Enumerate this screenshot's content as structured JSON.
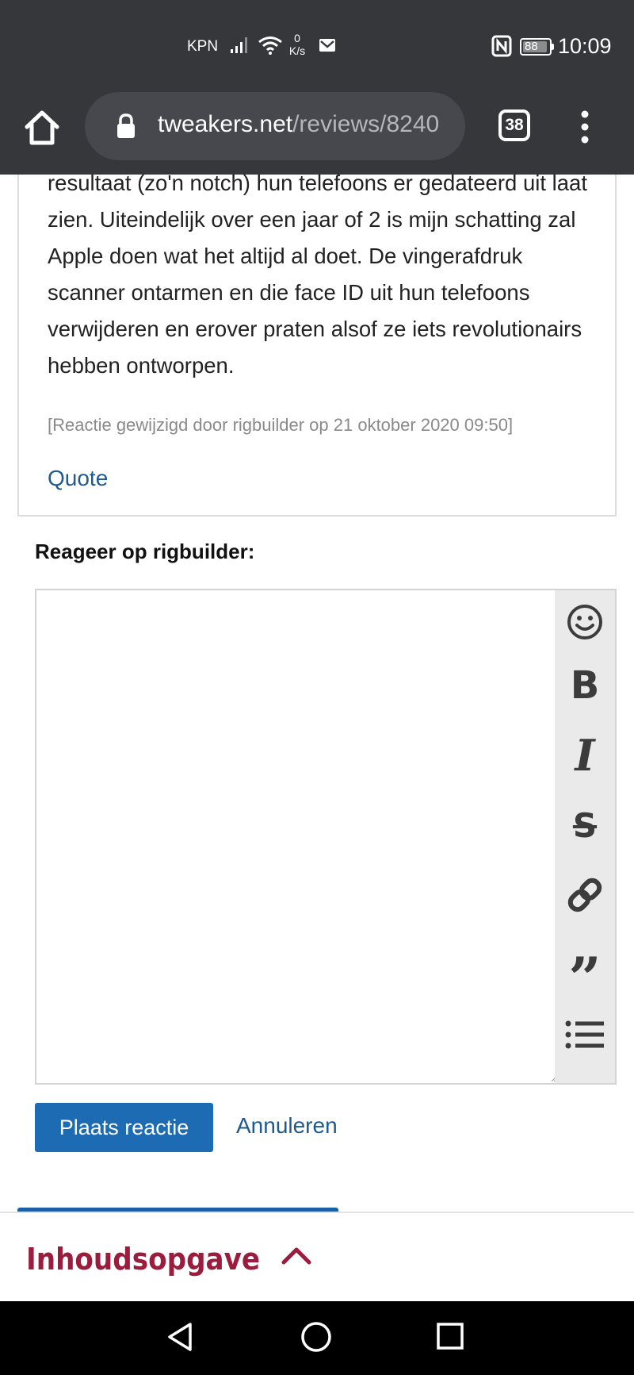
{
  "status_bar": {
    "carrier": "KPN",
    "speed_value": "0",
    "speed_unit": "K/s",
    "battery": "88",
    "time": "10:09"
  },
  "browser": {
    "url_host": "tweakers.net",
    "url_path": "/reviews/8240",
    "tab_count": "38"
  },
  "comment": {
    "text": "resultaat (zo'n notch) hun telefoons er gedateerd uit laat zien. Uiteindelijk over een jaar of 2 is mijn schatting zal Apple doen wat het altijd al doet. De vingerafdruk scanner ontarmen en die face ID uit hun telefoons verwijderen en erover praten alsof ze iets revolutionairs hebben ontworpen.",
    "edit_note": "[Reactie gewijzigd door rigbuilder op 21 oktober 2020 09:50]",
    "quote_label": "Quote"
  },
  "reply": {
    "heading": "Reageer op rigbuilder:",
    "textarea_value": "",
    "toolbar": {
      "bold_glyph": "B",
      "italic_glyph": "I",
      "strike_glyph": "S",
      "quote_glyph": "”",
      "icons": [
        "emoji-icon",
        "bold-icon",
        "italic-icon",
        "strikethrough-icon",
        "link-icon",
        "quote-icon",
        "list-icon"
      ]
    },
    "submit_label": "Plaats reactie",
    "cancel_label": "Annuleren"
  },
  "toc": {
    "label": "Inhoudsopgave"
  },
  "colors": {
    "chrome_bg": "#35373b",
    "link_blue": "#1e5a92",
    "button_blue": "#1d6bb3",
    "toc_red": "#9c1c3e"
  }
}
